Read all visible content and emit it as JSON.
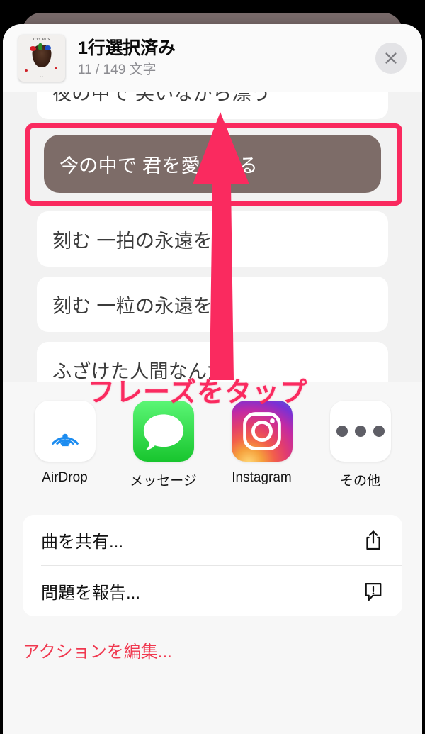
{
  "header": {
    "title": "1行選択済み",
    "subtitle": "11 / 149 文字",
    "close_icon": "close-x-icon",
    "artwork": {
      "alt": "album-artwork",
      "top_text": "CTS BUS",
      "bottom_text": "· ·"
    }
  },
  "lyrics": {
    "rows": [
      {
        "text": "夜の中で 笑いながら漂う",
        "selected": false,
        "partial": true
      },
      {
        "text": "今の中で 君を愛してる",
        "selected": true,
        "partial": false
      },
      {
        "text": "刻む 一拍の永遠を",
        "selected": false,
        "partial": false
      },
      {
        "text": "刻む 一粒の永遠を",
        "selected": false,
        "partial": false
      },
      {
        "text": "ふざけた人間なんだ",
        "selected": false,
        "partial": true
      }
    ]
  },
  "annotation": {
    "caption": "フレーズをタップ",
    "color": "#fa2a5f",
    "highlight_color": "#fa2a5f",
    "arrow_name": "pointer-arrow"
  },
  "share_apps": [
    {
      "label": "AirDrop",
      "icon": "airdrop-icon"
    },
    {
      "label": "メッセージ",
      "icon": "messages-icon"
    },
    {
      "label": "Instagram",
      "icon": "instagram-icon"
    },
    {
      "label": "その他",
      "icon": "more-ellipsis-icon"
    }
  ],
  "actions": [
    {
      "label": "曲を共有...",
      "icon": "share-up-arrow-icon"
    },
    {
      "label": "問題を報告...",
      "icon": "report-exclamation-bubble-icon"
    }
  ],
  "edit_actions": {
    "label": "アクションを編集...",
    "color": "#f0384f"
  }
}
